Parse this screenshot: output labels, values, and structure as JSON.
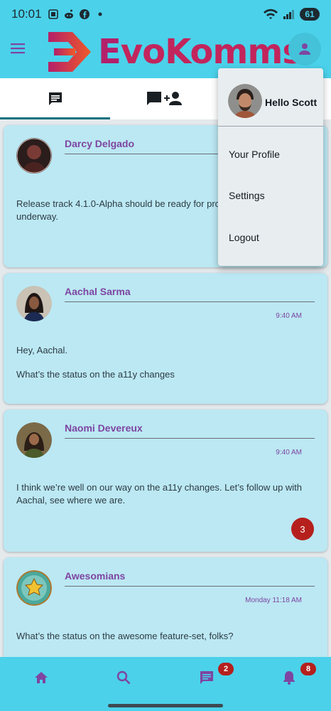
{
  "status_bar": {
    "time": "10:01",
    "battery": "61",
    "icons": [
      "screenshot-icon",
      "reddit-icon",
      "facebook-icon",
      "notification-dot-icon",
      "wifi-icon",
      "cellular-signal-icon"
    ]
  },
  "app": {
    "logo_text_first": "E",
    "logo_text_rest": "voKomms",
    "colors": {
      "primary": "#4bd1ea",
      "accent_purple": "#7e45a1",
      "card": "#bbe8f3",
      "badge_red": "#b5201d",
      "tab_indicator": "#11707e"
    }
  },
  "tabs": [
    {
      "name": "chats",
      "icon": "chat-icon",
      "active": true
    },
    {
      "name": "new-chat",
      "icon": "chat-add-user-icon",
      "active": false
    },
    {
      "name": "third",
      "icon": "",
      "active": false
    }
  ],
  "messages": [
    {
      "sender": "Darcy Delgado",
      "time": "",
      "body": "Release track 4.1.0-Alpha should be ready for produ underway.",
      "body_line1": "Release track 4.1.0-Alpha should be ready for produ",
      "body_line2": "underway.",
      "unread": ""
    },
    {
      "sender": "Aachal Sarma",
      "time": "9:40 AM",
      "body_line1": "Hey, Aachal.",
      "body_line2": "What’s the status on the a11y changes",
      "unread": ""
    },
    {
      "sender": "Naomi Devereux",
      "time": "9:40 AM",
      "body_line1": "I think we’re well on our way on the a11y changes. Let’s follow up with",
      "body_line2": "Aachal, see where we are.",
      "unread": "3"
    },
    {
      "sender": "Awesomians",
      "time": "Monday 11:18 AM",
      "body_line1": "What’s the status on the awesome feature-set, folks?",
      "body_line2": "",
      "unread": ""
    }
  ],
  "bottom_nav": {
    "items": [
      {
        "name": "home",
        "icon": "home-icon",
        "badge": ""
      },
      {
        "name": "search",
        "icon": "search-icon",
        "badge": ""
      },
      {
        "name": "messages",
        "icon": "message-icon",
        "badge": "2"
      },
      {
        "name": "notifications",
        "icon": "bell-icon",
        "badge": "8"
      }
    ]
  },
  "dropdown": {
    "greeting": "Hello Scott",
    "items": [
      "Your Profile",
      "Settings",
      "Logout"
    ]
  }
}
